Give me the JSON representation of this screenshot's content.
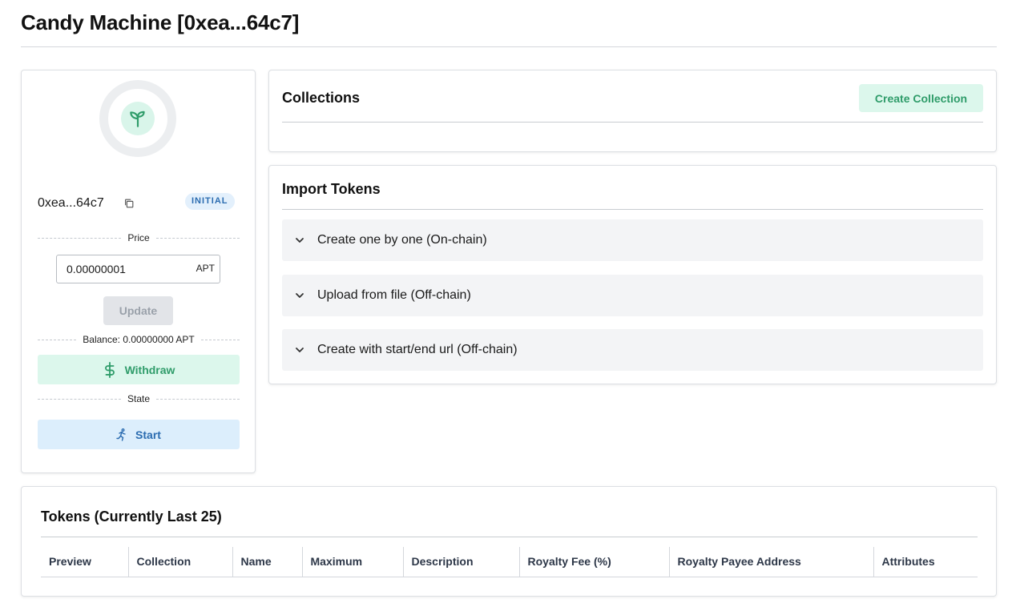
{
  "header": {
    "title": "Candy Machine [0xea...64c7]"
  },
  "machine": {
    "address": "0xea...64c7",
    "status_badge": "INITIAL",
    "price_label": "Price",
    "price_value": "0.00000001",
    "price_unit": "APT",
    "update_label": "Update",
    "balance_label": "Balance: 0.00000000 APT",
    "withdraw_label": "Withdraw",
    "state_label": "State",
    "start_label": "Start",
    "icons": {
      "avatar": "sprout-icon",
      "copy": "copy-icon",
      "withdraw": "dollar-sign-icon",
      "start": "running-person-icon"
    }
  },
  "collections": {
    "title": "Collections",
    "create_label": "Create Collection"
  },
  "import_tokens": {
    "title": "Import Tokens",
    "items": [
      {
        "label": "Create one by one (On-chain)"
      },
      {
        "label": "Upload from file (Off-chain)"
      },
      {
        "label": "Create with start/end url (Off-chain)"
      }
    ]
  },
  "tokens": {
    "title": "Tokens (Currently Last 25)",
    "columns": [
      "Preview",
      "Collection",
      "Name",
      "Maximum",
      "Description",
      "Royalty Fee (%)",
      "Royalty Payee Address",
      "Attributes"
    ]
  },
  "colors": {
    "accent_green": "#2f9c6a",
    "accent_green_bg": "#dcf7ec",
    "accent_blue": "#2b6cb0",
    "accent_blue_bg": "#dceefc",
    "accordion_bg": "#f3f4f6"
  }
}
